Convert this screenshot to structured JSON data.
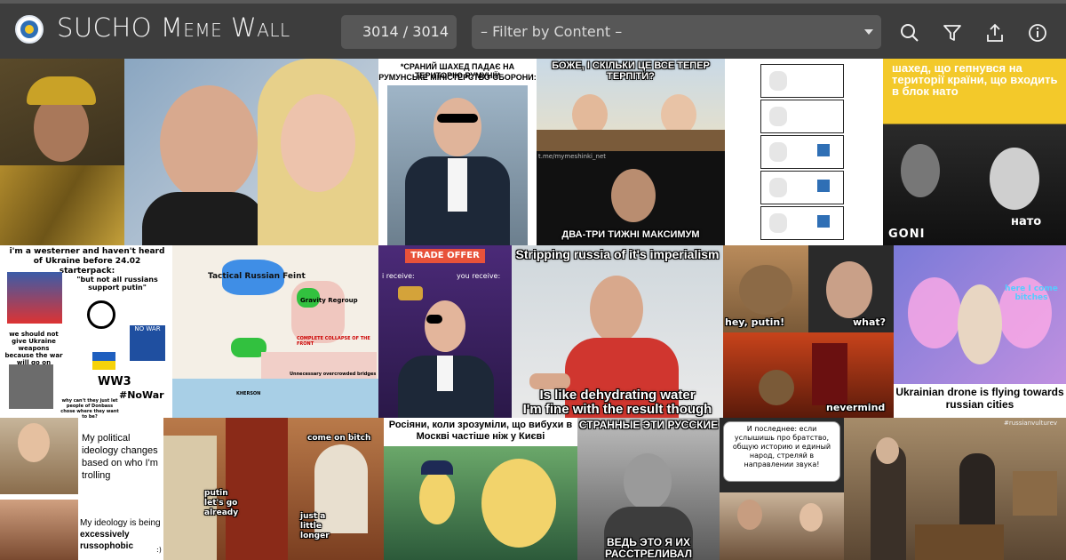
{
  "header": {
    "title_prefix": "SUCHO ",
    "title_meme": "Meme",
    "title_wall": "Wall",
    "counter": "3014 / 3014",
    "filter_placeholder": "– Filter by Content –"
  },
  "tiles": {
    "t3_top": "*СРАНИЙ ШАХЕД ПАДАЄ НА ТЕРИТОРІЮ РУМУНІЇ*",
    "t3_top2": "РУМУНСЬКЕ МІНІСТЕРСТВО ОБОРОНИ:",
    "t4_top": "БОЖЕ, І СКІЛЬКИ ЦЕ ВСЕ ТЕПЕР ТЕРПІТИ?",
    "t4_bottom": "ДВА-ТРИ ТИЖНІ МАКСИМУМ",
    "t4_wm": "t.me/mymeshinki_net",
    "t6_top": "шахед, що гепнувся на території країни, що входить в блок нато",
    "t6_bottom_left": "GONI",
    "t6_bottom_right": "нато",
    "t7_title": "i'm a westerner and haven't heard of Ukraine before 24.02 starterpack:",
    "t7_quote": "\"but not all russians support putin\"",
    "t7_weapons": "we should not give Ukraine weapons because the war will go on",
    "t7_ww3": "WW3",
    "t7_nowar": "#NoWar",
    "t7_donbas": "why can't they just let people of Donbass chose where they want to be?",
    "t7_sign": "NO WAR",
    "t8_label": "Tactical Russian Feint",
    "t8_gravity": "Gravity Regroup",
    "t8_collapse": "COMPLETE COLLAPSE OF THE FRONT",
    "t8_bridges": "Unnecessary overcrowded bridges",
    "t8_kherson": "KHERSON",
    "t9_offer": "TRADE OFFER",
    "t9_receive": "i receive:",
    "t9_you_receive": "you receive:",
    "t10_top": "Stripping russia of it's imperialism",
    "t10_b1": "Is like dehydrating water",
    "t10_b2": "I'm fine with the result though",
    "t11_hey": "hey, putin!",
    "t11_what": "what?",
    "t11_never": "nevermind",
    "t12_cat": "here I come bitches",
    "t12_cap": "Ukrainian drone is flying towards russian cities",
    "t13_a": "My political ideology changes based on who I'm trolling",
    "t13_b1": "My ideology is being ",
    "t13_b2": "excessively russophobic",
    "t13_smile": ":)",
    "t14_a": "come on bitch",
    "t14_b": "putin let's go already",
    "t14_c": "just a little longer",
    "t15_top": "Росіяни, коли зрозуміли, що вибухи в Москві частіше ніж у Києві",
    "t16_top": "СТРАННЫЕ ЭТИ РУССКИЕ",
    "t16_bottom": "ВЕДЬ ЭТО Я ИХ РАССТРЕЛИВАЛ",
    "t17_top": "И последнее: если услышишь про братство, общую историю и единый народ, стреляй в направлении звука!",
    "t18_wm": "#russianvulturev"
  },
  "colors": {
    "topbar": "#3d3d3d",
    "field": "#575757",
    "gold": "#c9a227",
    "ukraine_blue": "#1f5fbf",
    "ukraine_yellow": "#f5d20a"
  },
  "icons": [
    "search-icon",
    "filter-icon",
    "share-icon",
    "info-icon"
  ]
}
